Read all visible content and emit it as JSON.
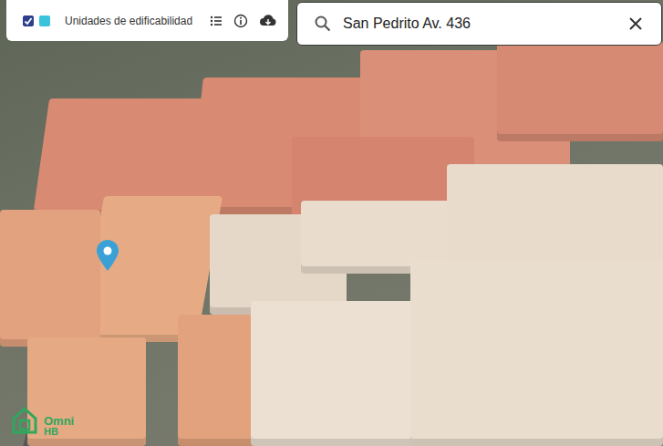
{
  "layer_panel": {
    "checked": true,
    "color": "#3cc3dc",
    "label": "Unidades de edificabilidad"
  },
  "search": {
    "value": "San Pedrito Av. 436"
  },
  "map": {
    "pin_shown": true
  },
  "logo": {
    "name": "Omni",
    "sub": "HB"
  }
}
